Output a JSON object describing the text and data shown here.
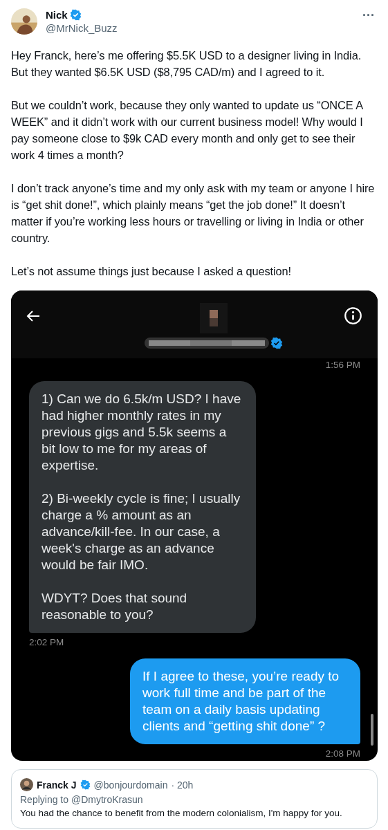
{
  "author": {
    "name": "Nick",
    "verified": true,
    "handle": "@MrNick_Buzz"
  },
  "more": "···",
  "paragraphs": [
    "Hey Franck, here’s me offering $5.5K USD to a designer living in India. But they wanted $6.5K USD ($8,795 CAD/m) and I agreed to it.",
    "But we couldn’t work, because they only wanted to update us “ONCE A WEEK” and it didn’t work with our current business model! Why would I pay someone close to $9k CAD every month and only get to see their work 4 times a month?",
    "I don’t track anyone’s time and my only ask with my team or anyone I hire is “get shit done!”, which plainly means “get the job done!” It doesn’t matter if you’re working less hours or travelling or living in India or other country.",
    "Let’s not assume things just because I asked a question!"
  ],
  "chat": {
    "verified": true,
    "first_time": "1:56 PM",
    "messages": [
      {
        "kind": "received",
        "paragraphs": [
          "1) Can we do 6.5k/m USD? I have had higher monthly rates in my previous gigs and 5.5k seems a bit low to me for my areas of expertise.",
          "2) Bi-weekly cycle is fine; I usually charge a % amount as an advance/kill-fee. In our case, a week's charge as an advance would be fair IMO.",
          "WDYT? Does that sound reasonable to you?"
        ],
        "time": "2:02 PM"
      },
      {
        "kind": "sent",
        "paragraphs": [
          "If I agree to these, you’re ready to work full time and be part of the team on a daily basis updating clients and “getting shit done” ?"
        ],
        "time": "2:08 PM"
      }
    ]
  },
  "quote": {
    "name": "Franck J",
    "verified": true,
    "handle": "@bonjourdomain",
    "time": "· 20h",
    "replying": "Replying to @DmytroKrasun",
    "text": "You had the chance to benefit from the modern colonialism, I'm happy for you."
  }
}
